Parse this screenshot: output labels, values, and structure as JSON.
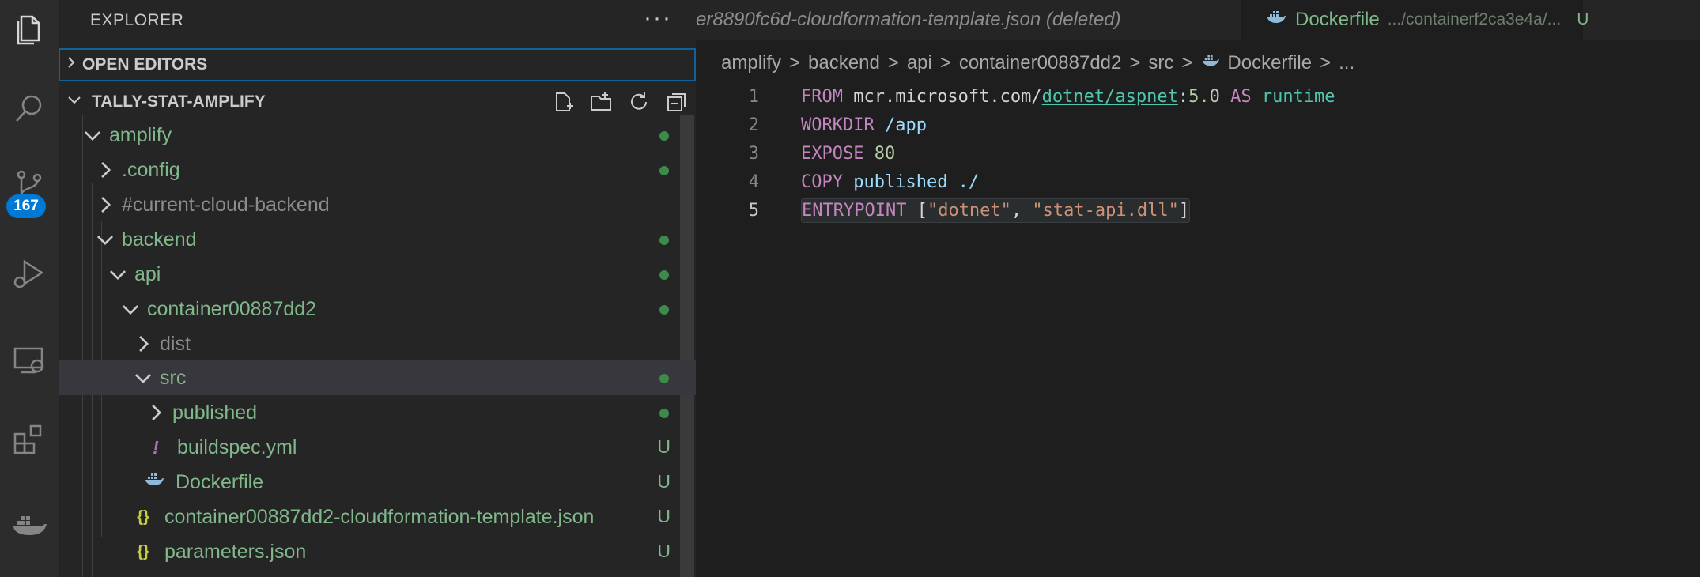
{
  "activity_bar": {
    "icons": [
      "explorer-icon",
      "search-icon",
      "source-control-icon",
      "run-debug-icon",
      "remote-explorer-icon",
      "extensions-icon",
      "docker-icon"
    ],
    "source_control_badge": "167"
  },
  "sidebar": {
    "title": "EXPLORER",
    "more": "···",
    "open_editors": "OPEN EDITORS",
    "workspace": "TALLY-STAT-AMPLIFY",
    "tree": [
      {
        "label": "amplify",
        "status": "dot"
      },
      {
        "label": ".config",
        "status": "dot"
      },
      {
        "label": "#current-cloud-backend",
        "status": ""
      },
      {
        "label": "backend",
        "status": "dot"
      },
      {
        "label": "api",
        "status": "dot"
      },
      {
        "label": "container00887dd2",
        "status": "dot"
      },
      {
        "label": "dist",
        "status": ""
      },
      {
        "label": "src",
        "status": "dot"
      },
      {
        "label": "published",
        "status": "dot"
      },
      {
        "label": "buildspec.yml",
        "status": "U"
      },
      {
        "label": "Dockerfile",
        "status": "U"
      },
      {
        "label": "container00887dd2-cloudformation-template.json",
        "status": "U"
      },
      {
        "label": "parameters.json",
        "status": "U"
      }
    ]
  },
  "editor": {
    "tab_inactive": "er8890fc6d-cloudformation-template.json (deleted)",
    "tab_active": {
      "name": "Dockerfile",
      "path": ".../containerf2ca3e4a/...",
      "status": "U"
    },
    "breadcrumb": [
      "amplify",
      "backend",
      "api",
      "container00887dd2",
      "src",
      "Dockerfile",
      "..."
    ],
    "lines": [
      {
        "n": "1",
        "parts": [
          "FROM",
          " mcr.microsoft.com/",
          "dotnet/aspnet",
          ":",
          "5.0",
          " AS ",
          "runtime"
        ]
      },
      {
        "n": "2",
        "parts": [
          "WORKDIR",
          " /app"
        ]
      },
      {
        "n": "3",
        "parts": [
          "EXPOSE",
          " ",
          "80"
        ]
      },
      {
        "n": "4",
        "parts": [
          "COPY",
          " published ./"
        ]
      },
      {
        "n": "5",
        "parts": [
          "ENTRYPOINT",
          " [",
          "\"dotnet\"",
          ", ",
          "\"stat-api.dll\"",
          "]"
        ]
      }
    ]
  },
  "colors": {
    "accent": "#0078d4",
    "git_untracked": "#81b88b"
  }
}
